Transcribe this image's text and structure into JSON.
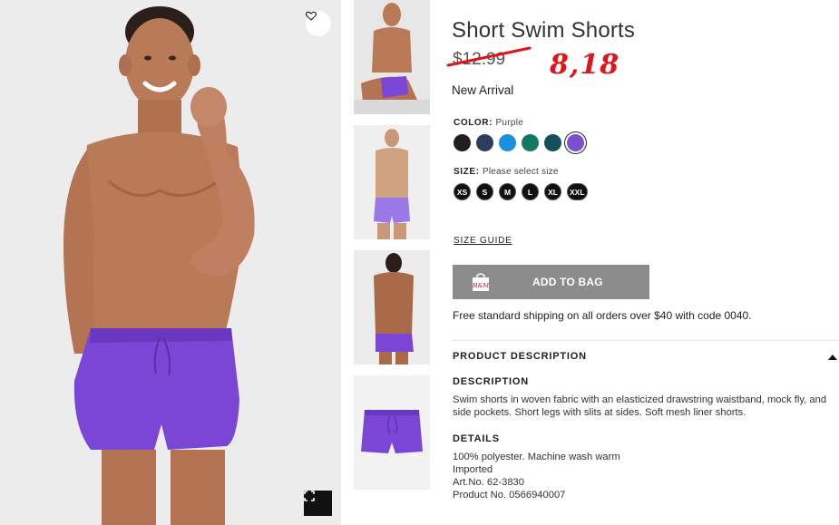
{
  "product": {
    "title": "Short Swim Shorts",
    "old_price": "$12.99",
    "handwritten_price": "8,18",
    "badge": "New Arrival"
  },
  "color": {
    "label": "COLOR:",
    "selected": "Purple",
    "swatches": [
      {
        "name": "Black",
        "hex": "#1f1f1f"
      },
      {
        "name": "Dark blue",
        "hex": "#2c3e5c"
      },
      {
        "name": "Blue",
        "hex": "#1d8fe0"
      },
      {
        "name": "Green",
        "hex": "#127a63"
      },
      {
        "name": "Dark turquoise",
        "hex": "#144f5a"
      },
      {
        "name": "Purple",
        "hex": "#7a4fd0"
      }
    ]
  },
  "size": {
    "label": "SIZE:",
    "prompt": "Please select size",
    "options": [
      "XS",
      "S",
      "M",
      "L",
      "XL",
      "XXL"
    ]
  },
  "size_guide": "SIZE GUIDE",
  "add_to_bag": "ADD TO BAG",
  "bag_icon_text": "H&M",
  "shipping": "Free standard shipping on all orders over $40 with code 0040.",
  "product_description": {
    "header": "PRODUCT DESCRIPTION",
    "description_heading": "DESCRIPTION",
    "description": "Swim shorts in woven fabric with an elasticized drawstring waistband, mock fly, and side pockets. Short legs with slits at sides. Soft mesh liner shorts.",
    "details_heading": "DETAILS",
    "details": [
      "100% polyester. Machine wash warm",
      "Imported",
      "Art.No. 62-3830",
      "Product No. 0566940007"
    ]
  },
  "colors": {
    "shorts": "#7b45d6",
    "skin": "#b97a57",
    "button_bg": "#8c8c8c",
    "handwriting": "#e0141b"
  },
  "icons": {
    "favorite": "heart-icon",
    "expand": "expand-icon",
    "bag": "shopping-bag-icon",
    "collapse": "caret-up-icon"
  }
}
